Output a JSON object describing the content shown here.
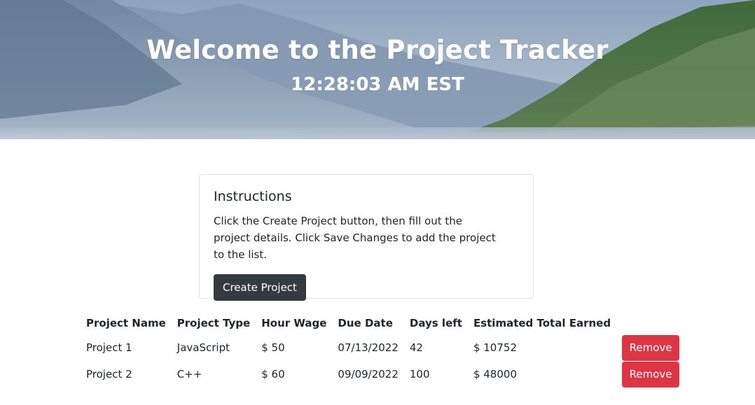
{
  "header": {
    "title": "Welcome to the Project Tracker",
    "time": "12:28:03 AM EST"
  },
  "instructions": {
    "title": "Instructions",
    "text": "Click the Create Project button, then fill out the project details. Click Save Changes to add the project to the list.",
    "create_button": "Create Project"
  },
  "table": {
    "headers": [
      "Project Name",
      "Project Type",
      "Hour Wage",
      "Due Date",
      "Days left",
      "Estimated Total Earned"
    ],
    "rows": [
      {
        "name": "Project 1",
        "type": "JavaScript",
        "wage": "$ 50",
        "due": "07/13/2022",
        "days_left": "42",
        "total": "$ 10752",
        "action": "Remove"
      },
      {
        "name": "Project 2",
        "type": "C++",
        "wage": "$ 60",
        "due": "09/09/2022",
        "days_left": "100",
        "total": "$ 48000",
        "action": "Remove"
      }
    ]
  },
  "colors": {
    "dark_button": "#343a40",
    "danger_button": "#dc3545"
  }
}
